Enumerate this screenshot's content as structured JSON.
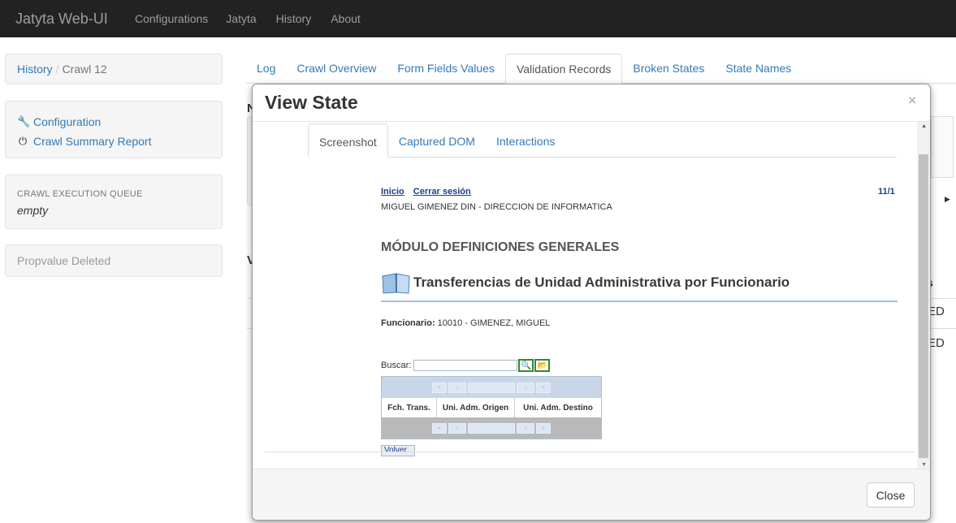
{
  "navbar": {
    "brand": "Jatyta Web-UI",
    "items": [
      "Configurations",
      "Jatyta",
      "History",
      "About"
    ]
  },
  "sidebar": {
    "breadcrumb": {
      "link": "History",
      "separator": "/",
      "current": "Crawl 12"
    },
    "links": [
      {
        "icon": "wrench-icon",
        "label": "Configuration"
      },
      {
        "icon": "power-icon",
        "label": "Crawl Summary Report"
      }
    ],
    "queue": {
      "title": "CRAWL EXECUTION QUEUE",
      "value": "empty"
    },
    "alert": "Propvalue Deleted"
  },
  "main": {
    "tabs": [
      "Log",
      "Crawl Overview",
      "Form Fields Values",
      "Validation Records",
      "Broken States",
      "State Names"
    ],
    "active_tab": "Validation Records",
    "partial": {
      "n": "N",
      "v": "V",
      "s": "s",
      "d1": "ED",
      "d2": "ED"
    }
  },
  "modal": {
    "title": "View State",
    "close_symbol": "×",
    "tabs": [
      "Screenshot",
      "Captured DOM",
      "Interactions"
    ],
    "active_tab": "Screenshot",
    "close_button": "Close",
    "screenshot": {
      "links": [
        "Inicio",
        "Cerrar sesión"
      ],
      "page": "11/1",
      "user": "MIGUEL GIMENEZ   DIN - DIRECCION DE INFORMATICA",
      "module": "MÓDULO DEFINICIONES GENERALES",
      "heading": "Transferencias de Unidad Administrativa por Funcionario",
      "funcionario_label": "Funcionario:",
      "funcionario_value": " 10010 - GIMENEZ, MIGUEL",
      "buscar_label": "Buscar:",
      "columns": [
        "Fch. Trans.",
        "Uni. Adm. Origen",
        "Uni. Adm. Destino"
      ],
      "volver": "Volver"
    }
  },
  "colors": {
    "navbar": "#222222",
    "link": "#337ab7",
    "legacy_link": "#1a3d8f",
    "highlight_border": "#2f8a2f"
  }
}
